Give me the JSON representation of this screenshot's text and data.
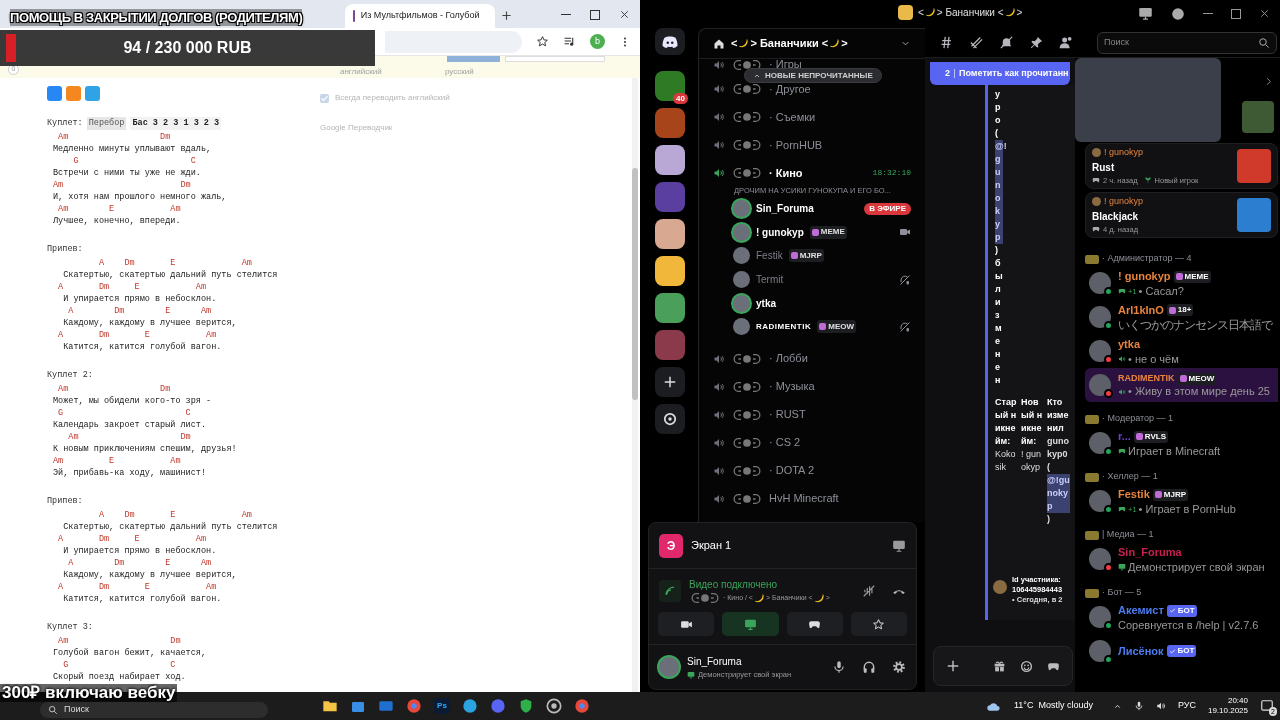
{
  "stream_overlay": {
    "goal_title": "ПОМОЩЬ В ЗАКРЫТИИ ДОЛГОВ (РОДИТЕЛЯМ)",
    "goal_amount": "94 / 230 000 RUB",
    "level": 0.0004,
    "webcam_note": "300₽ включаю вебку"
  },
  "browser": {
    "tabs": [
      {
        "title": "Из Мультфильмов - Голубой",
        "selected": true
      }
    ],
    "profile_initial": "b",
    "badge": "0",
    "translate_popup": {
      "source": "английский",
      "target": "русский",
      "always": "Всегда переводить английский",
      "always_checked": true,
      "brand": "Google Переводчик"
    },
    "sections": [
      {
        "heading": "Куплет:",
        "chips": [
          "Перебор",
          "Бас 3 2 3 1 3 2 3"
        ],
        "lines": [
          {
            "kind": "chord",
            "text": " Am                  Dm"
          },
          {
            "kind": "lyric",
            "text": "Медленно минуты уплывают вдаль,"
          },
          {
            "kind": "chord",
            "text": "    G                      C"
          },
          {
            "kind": "lyric",
            "text": "Встречи с ними ты уже не жди."
          },
          {
            "kind": "chord",
            "text": "Am                       Dm"
          },
          {
            "kind": "lyric",
            "text": "И, хотя нам прошлого немного жаль,"
          },
          {
            "kind": "chord",
            "text": " Am        E           Am"
          },
          {
            "kind": "lyric",
            "text": "Лучшее, конечно, впереди."
          }
        ]
      },
      {
        "heading": "Припев:",
        "lines": [
          {
            "kind": "chord",
            "text": "         A    Dm       E             Am"
          },
          {
            "kind": "lyric",
            "text": "  Скатертью, скатертью дальний путь стелится"
          },
          {
            "kind": "chord",
            "text": " A       Dm     E           Am"
          },
          {
            "kind": "lyric",
            "text": "  И упирается прямо в небосклон."
          },
          {
            "kind": "chord",
            "text": "   A        Dm        E      Am"
          },
          {
            "kind": "lyric",
            "text": "  Каждому, каждому в лучшее верится,"
          },
          {
            "kind": "chord",
            "text": " A       Dm       E           Am"
          },
          {
            "kind": "lyric",
            "text": "  Катится, катится голубой вагон."
          }
        ]
      },
      {
        "heading": "Куплет 2:",
        "lines": [
          {
            "kind": "chord",
            "text": " Am                  Dm"
          },
          {
            "kind": "lyric",
            "text": "Может, мы обидели кого-то зря -"
          },
          {
            "kind": "chord",
            "text": " G                        C"
          },
          {
            "kind": "lyric",
            "text": "Календарь закроет старый лист."
          },
          {
            "kind": "chord",
            "text": "   Am                    Dm"
          },
          {
            "kind": "lyric",
            "text": "К новым приключениям спешим, друзья!"
          },
          {
            "kind": "chord",
            "text": "Am         E           Am"
          },
          {
            "kind": "lyric",
            "text": "Эй, прибавь-ка ходу, машинист!"
          }
        ]
      },
      {
        "heading": "Припев:",
        "lines": [
          {
            "kind": "chord",
            "text": "         A    Dm       E             Am"
          },
          {
            "kind": "lyric",
            "text": "  Скатертью, скатертью дальний путь стелится"
          },
          {
            "kind": "chord",
            "text": " A       Dm     E           Am"
          },
          {
            "kind": "lyric",
            "text": "  И упирается прямо в небосклон."
          },
          {
            "kind": "chord",
            "text": "   A        Dm        E      Am"
          },
          {
            "kind": "lyric",
            "text": "  Каждому, каждому в лучшее верится,"
          },
          {
            "kind": "chord",
            "text": " A       Dm       E           Am"
          },
          {
            "kind": "lyric",
            "text": "  Катится, катится голубой вагон."
          }
        ]
      },
      {
        "heading": "Куплет 3:",
        "lines": [
          {
            "kind": "chord",
            "text": " Am                    Dm"
          },
          {
            "kind": "lyric",
            "text": "Голубой вагон бежит, качается,"
          },
          {
            "kind": "chord",
            "text": "  G                    C"
          },
          {
            "kind": "lyric",
            "text": "Скорый поезд набирает ход."
          }
        ]
      }
    ]
  },
  "discord": {
    "window_title": [
      "<",
      "> Бананчики <",
      ">"
    ],
    "server_name": [
      "<",
      "> Бананчики <",
      ">"
    ],
    "server_badges": [
      {
        "badge": "40"
      }
    ],
    "unread_pill": "НОВЫЕ НЕПРОЧИТАННЫЕ",
    "channels": [
      {
        "name": "· Игры",
        "active": false
      },
      {
        "name": "· Другое",
        "active": false
      },
      {
        "name": "· Съемки",
        "active": false
      },
      {
        "name": "· PornHUB",
        "active": false
      },
      {
        "name": "· Кино",
        "active": true,
        "time": "18:32:10",
        "status": "ДРОЧИМ НА УСИКИ ГУНОКУПА И ЕГО БО...",
        "members": [
          {
            "name": "Sin_Foruma",
            "speaking": true,
            "dim": false,
            "kind": "live",
            "badge": "В ЭФИРЕ"
          },
          {
            "name": "! gunokyp",
            "speaking": true,
            "dim": false,
            "tag": "MEME",
            "kind": "video"
          },
          {
            "name": "Festik",
            "speaking": false,
            "dim": true,
            "tag": "MJRP",
            "kind": "plain"
          },
          {
            "name": "Termit",
            "speaking": false,
            "dim": true,
            "kind": "deafened"
          },
          {
            "name": "ytka",
            "speaking": true,
            "dim": false,
            "kind": "plain"
          },
          {
            "name": "RADIMENTIK",
            "speaking": false,
            "dim": false,
            "tag": "MEOW",
            "kind": "deafened"
          }
        ]
      },
      {
        "name": "· Лобби",
        "active": false
      },
      {
        "name": "· Музыка",
        "active": false
      },
      {
        "name": "· RUST",
        "active": false
      },
      {
        "name": "· CS 2",
        "active": false
      },
      {
        "name": "· DOTA 2",
        "active": false
      },
      {
        "name": "HvH Minecraft",
        "active": false
      }
    ],
    "voice_panel": {
      "app_initial": "Э",
      "app_title": "Экран 1",
      "status": "Видео подключено",
      "location": [
        "· Кино / <",
        "> Бананчики <",
        ">"
      ],
      "user": "Sin_Foruma",
      "user_status": "Демонстрирует свой экран"
    },
    "search_placeholder": "Поиск",
    "unread_bar": {
      "count": "2",
      "label": "Пометить как прочитанн"
    },
    "embed": {
      "text_before": "уро (",
      "mention": "@!gunokyp",
      "text_after": ") был изменен",
      "fields": [
        {
          "name": "Старый никнейм:",
          "value": "Kokosik"
        },
        {
          "name": "Новый никнейм:",
          "value": "! gunokyp"
        },
        {
          "name": "Кто изменил",
          "value": "gunokyp0 (",
          "mention": "@!gunokyp",
          "value_end": ")"
        }
      ],
      "footer_id": "Id участника: 106445984443",
      "footer_time": "• Сегодня, в 2"
    },
    "activities": [
      {
        "user": "! gunokyp",
        "game": "Rust",
        "time": "2 ч. назад",
        "extra": "Новый игрок",
        "kind": "rust"
      },
      {
        "user": "! gunokyp",
        "game": "Blackjack",
        "time": "4 д. назад",
        "kind": "cards"
      }
    ],
    "groups": [
      {
        "title": "· Администратор — 4",
        "members": [
          {
            "name": "! gunokyp",
            "color": "#e8843c",
            "dnd": false,
            "tag": {
              "kind": "role",
              "label": "MEME"
            },
            "kind": "game",
            "extra": "+1",
            "status": "• Сасал?"
          },
          {
            "name": "Arl1kInO",
            "color": "#e8843c",
            "dnd": false,
            "tag": {
              "kind": "role",
              "label": "18+"
            },
            "kind": "custom",
            "status": "いくつかのナンセンス日本語で"
          },
          {
            "name": "ytka",
            "color": "#e8843c",
            "dnd": true,
            "kind": "voice",
            "status": "• не о чём"
          },
          {
            "name": "RADIMENTIK",
            "color": "#e8843c",
            "dnd": true,
            "nameplate": true,
            "tag": {
              "kind": "role",
              "label": "MEOW"
            },
            "kind": "voice",
            "status": "• Живу в этом мире день 25"
          }
        ]
      },
      {
        "title": "· Модератор — 1",
        "members": [
          {
            "name": "r...",
            "color": "#6b3fd4",
            "dnd": false,
            "tag": {
              "kind": "role",
              "label": "RVLS"
            },
            "kind": "game",
            "status": "Играет в Minecraft"
          }
        ]
      },
      {
        "title": "· Хеллер — 1",
        "members": [
          {
            "name": "Festik",
            "color": "#e8843c",
            "dnd": false,
            "tag": {
              "kind": "role",
              "label": "MJRP"
            },
            "kind": "game",
            "extra": "+1",
            "status": "• Играет в PornHub"
          }
        ]
      },
      {
        "title": "| Медиа — 1",
        "members": [
          {
            "name": "Sin_Foruma",
            "color": "#c8204f",
            "dnd": true,
            "kind": "screen",
            "status": "Демонстрирует свой экран"
          }
        ]
      },
      {
        "title": "· Бот — 5",
        "members": [
          {
            "name": "Акемист",
            "color": "#4d7cf0",
            "dnd": false,
            "tag": {
              "kind": "bot",
              "label": "БОТ"
            },
            "kind": "activity",
            "status": "Соревнуется в /help | v2.7.6"
          },
          {
            "name": "Лисёнок",
            "color": "#4d7cf0",
            "dnd": false,
            "tag": {
              "kind": "bot",
              "label": "БОТ"
            }
          }
        ]
      }
    ]
  },
  "taskbar": {
    "search": "Поиск",
    "apps": [
      {
        "kind": "folder"
      },
      {
        "kind": "store"
      },
      {
        "kind": "mail"
      },
      {
        "kind": "chrome"
      },
      {
        "kind": "label",
        "label": "Ps"
      },
      {
        "kind": "telegram"
      },
      {
        "kind": "discord"
      },
      {
        "kind": "shield"
      },
      {
        "kind": "obs"
      },
      {
        "kind": "chrome"
      }
    ],
    "temperature": "11°C",
    "weather": "Mostly cloudy",
    "language": "РУС",
    "time": "20:40",
    "date": "19.10.2025",
    "notifications": "2"
  }
}
